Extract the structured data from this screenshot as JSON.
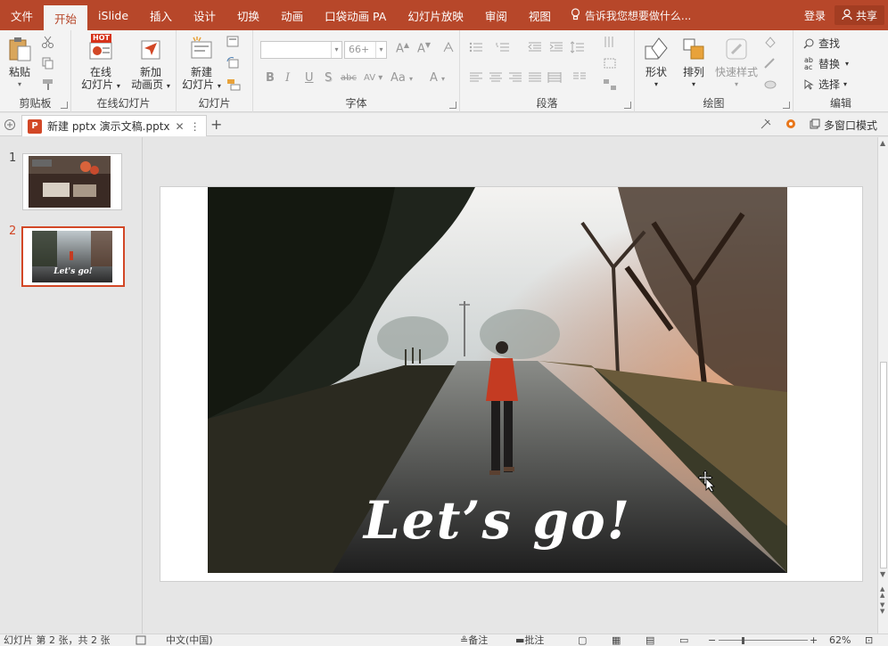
{
  "menu": {
    "tabs": [
      "文件",
      "开始",
      "iSlide",
      "插入",
      "设计",
      "切换",
      "动画",
      "口袋动画 PA",
      "幻灯片放映",
      "审阅",
      "视图"
    ],
    "active_index": 1,
    "tell_me": "告诉我您想要做什么...",
    "login": "登录",
    "share": "共享"
  },
  "ribbon": {
    "clipboard": {
      "label": "剪贴板",
      "paste": "粘贴"
    },
    "online_slides": {
      "label": "在线幻灯片",
      "online_line1": "在线",
      "online_line2": "幻灯片",
      "hot": "HOT",
      "new_anim_line1": "新加",
      "new_anim_line2": "动画页"
    },
    "slides": {
      "label": "幻灯片",
      "new_line1": "新建",
      "new_line2": "幻灯片"
    },
    "font": {
      "label": "字体",
      "font_name": "",
      "font_size": "66+",
      "bold": "B",
      "italic": "I",
      "underline": "U",
      "shadow": "S",
      "strike": "abc",
      "spacing": "AV",
      "case": "Aa",
      "color": "A"
    },
    "paragraph": {
      "label": "段落"
    },
    "drawing": {
      "label": "绘图",
      "shapes": "形状",
      "arrange": "排列",
      "quick_styles": "快速样式"
    },
    "editing": {
      "label": "编辑",
      "find": "查找",
      "replace": "替换",
      "select": "选择"
    }
  },
  "document": {
    "tab_title": "新建 pptx 演示文稿.pptx",
    "multi_window": "多窗口模式"
  },
  "thumbnails": [
    {
      "number": "1"
    },
    {
      "number": "2",
      "caption": "Let's go!"
    }
  ],
  "slide": {
    "title": "Let’s go!"
  },
  "status": {
    "slide_info": "幻灯片 第 2 张，共 2 张",
    "language": "中文(中国)",
    "notes": "备注",
    "comments": "批注",
    "zoom": "62%"
  },
  "colors": {
    "accent": "#b7472a",
    "selection": "#d24726"
  }
}
